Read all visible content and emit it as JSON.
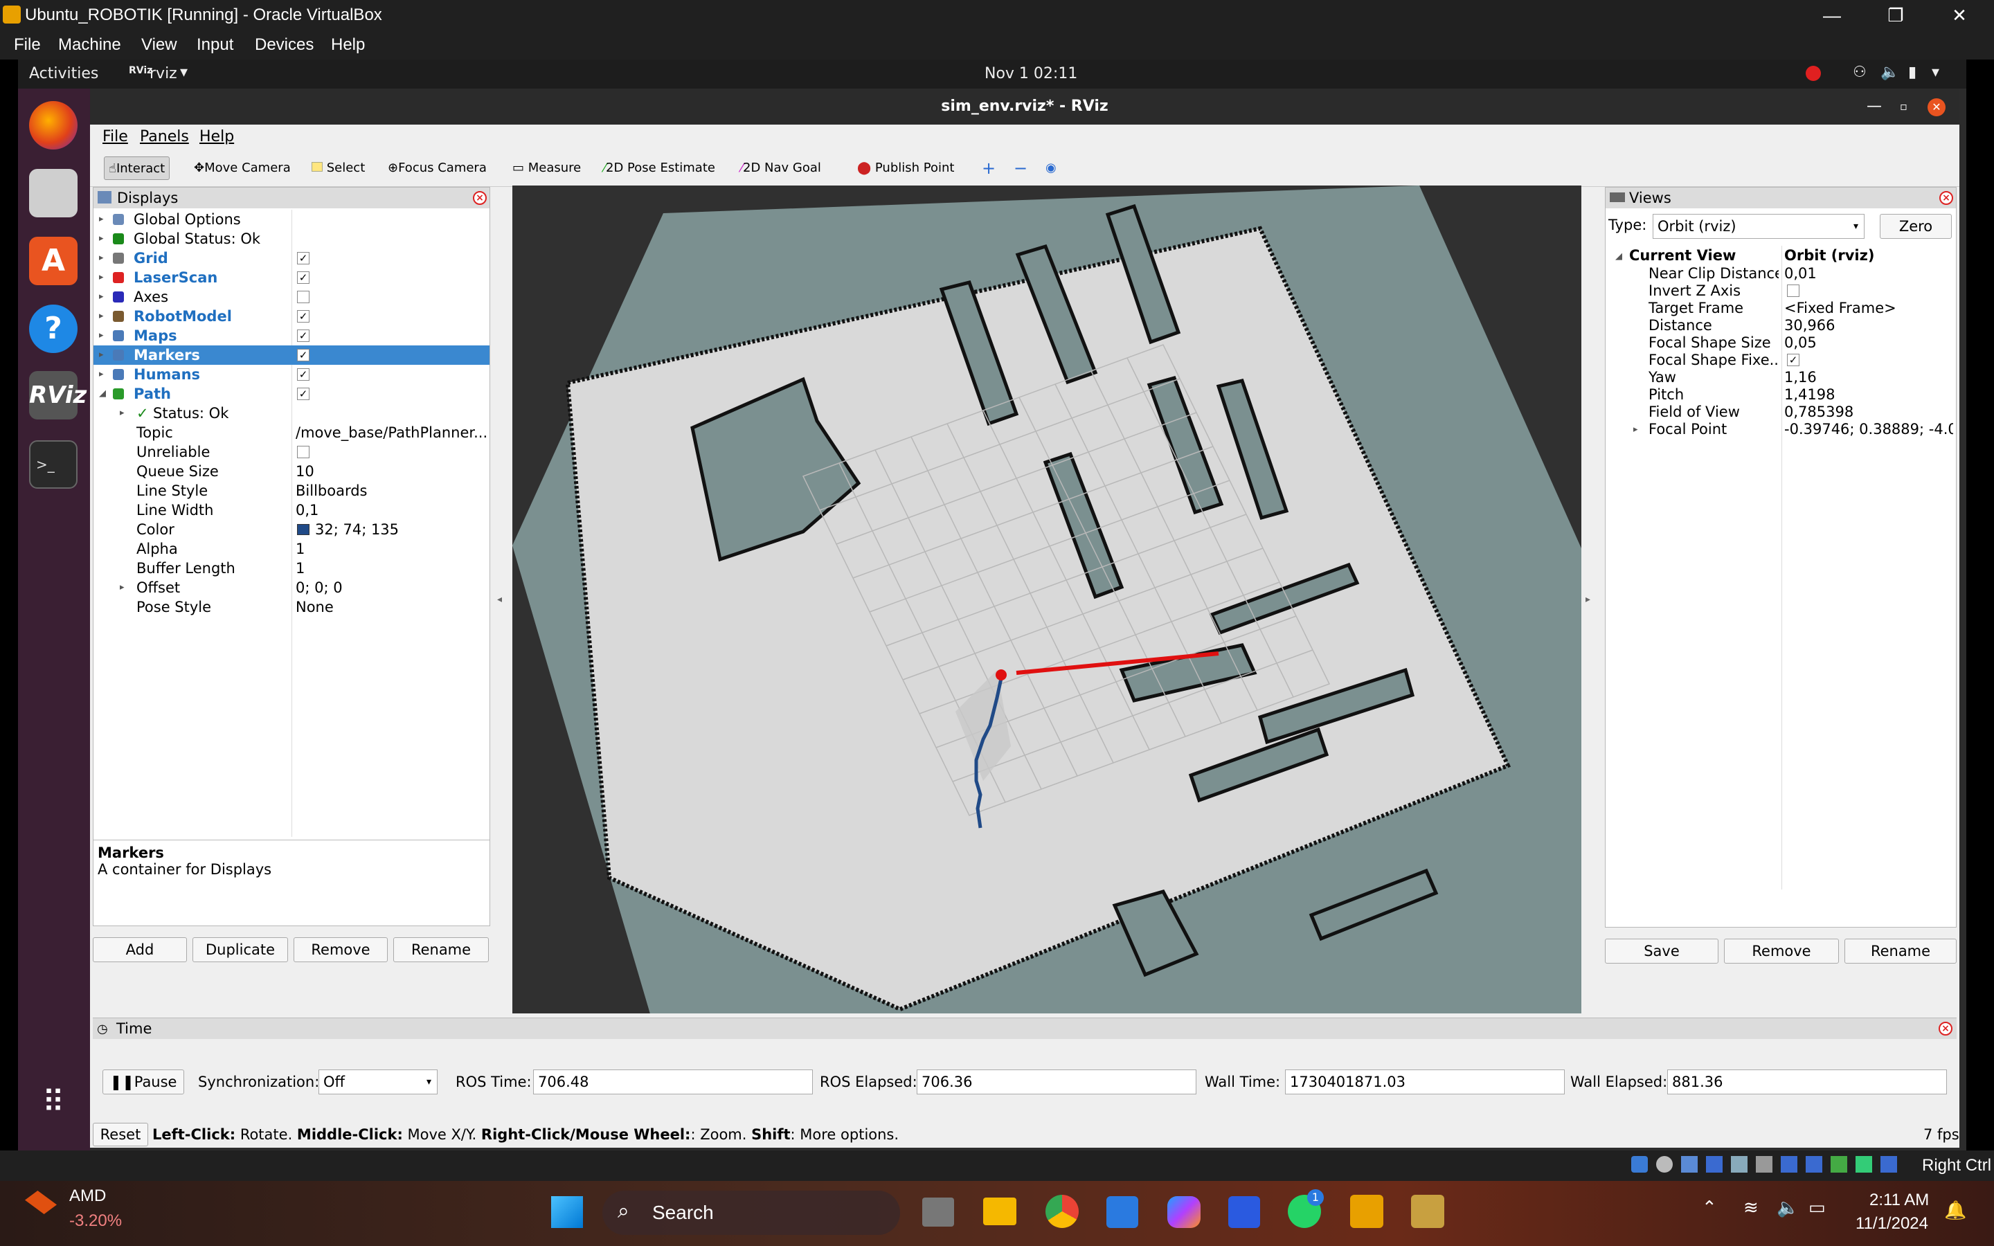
{
  "vbox": {
    "title": "Ubuntu_ROBOTIK [Running] - Oracle VirtualBox",
    "menu": [
      "File",
      "Machine",
      "View",
      "Input",
      "Devices",
      "Help"
    ],
    "status_right": "Right Ctrl"
  },
  "gnome": {
    "activities": "Activities",
    "app": "rviz",
    "clock": "Nov 1  02:11"
  },
  "rviz": {
    "title": "sim_env.rviz* - RViz",
    "menu": [
      "File",
      "Panels",
      "Help"
    ],
    "toolbar": [
      "Interact",
      "Move Camera",
      "Select",
      "Focus Camera",
      "Measure",
      "2D Pose Estimate",
      "2D Nav Goal",
      "Publish Point"
    ],
    "displays": {
      "title": "Displays",
      "items": [
        {
          "label": "Global Options",
          "value": ""
        },
        {
          "label": "Global Status: Ok",
          "value": ""
        },
        {
          "label": "Grid",
          "value": "checked"
        },
        {
          "label": "LaserScan",
          "value": "checked"
        },
        {
          "label": "Axes",
          "value": "unchecked"
        },
        {
          "label": "RobotModel",
          "value": "checked"
        },
        {
          "label": "Maps",
          "value": "checked"
        },
        {
          "label": "Markers",
          "value": "checked"
        },
        {
          "label": "Humans",
          "value": "checked"
        },
        {
          "label": "Path",
          "value": "checked"
        }
      ],
      "path_props": [
        {
          "label": "Status: Ok",
          "value": ""
        },
        {
          "label": "Topic",
          "value": "/move_base/PathPlanner..."
        },
        {
          "label": "Unreliable",
          "value": ""
        },
        {
          "label": "Queue Size",
          "value": "10"
        },
        {
          "label": "Line Style",
          "value": "Billboards"
        },
        {
          "label": "Line Width",
          "value": "0,1"
        },
        {
          "label": "Color",
          "value": "32; 74; 135"
        },
        {
          "label": "Alpha",
          "value": "1"
        },
        {
          "label": "Buffer Length",
          "value": "1"
        },
        {
          "label": "Offset",
          "value": "0; 0; 0"
        },
        {
          "label": "Pose Style",
          "value": "None"
        }
      ],
      "desc_title": "Markers",
      "desc_text": "A container for Displays",
      "buttons": [
        "Add",
        "Duplicate",
        "Remove",
        "Rename"
      ]
    },
    "views": {
      "title": "Views",
      "type_label": "Type:",
      "type_value": "Orbit (rviz)",
      "zero": "Zero",
      "current_view": "Current View",
      "current_view_value": "Orbit (rviz)",
      "props": [
        {
          "label": "Near Clip Distance",
          "value": "0,01"
        },
        {
          "label": "Invert Z Axis",
          "value": ""
        },
        {
          "label": "Target Frame",
          "value": "<Fixed Frame>"
        },
        {
          "label": "Distance",
          "value": "30,966"
        },
        {
          "label": "Focal Shape Size",
          "value": "0,05"
        },
        {
          "label": "Focal Shape Fixe...",
          "value": ""
        },
        {
          "label": "Yaw",
          "value": "1,16"
        },
        {
          "label": "Pitch",
          "value": "1,4198"
        },
        {
          "label": "Field of View",
          "value": "0,785398"
        },
        {
          "label": "Focal Point",
          "value": "-0.39746; 0.38889; -4.0..."
        }
      ],
      "buttons": [
        "Save",
        "Remove",
        "Rename"
      ]
    },
    "time": {
      "title": "Time",
      "pause": "Pause",
      "sync_label": "Synchronization:",
      "sync_value": "Off",
      "ros_time_label": "ROS Time:",
      "ros_time": "706.48",
      "ros_elapsed_label": "ROS Elapsed:",
      "ros_elapsed": "706.36",
      "wall_time_label": "Wall Time:",
      "wall_time": "1730401871.03",
      "wall_elapsed_label": "Wall Elapsed:",
      "wall_elapsed": "881.36"
    },
    "status": {
      "reset": "Reset",
      "lc": "Left-Click:",
      "lc_t": " Rotate. ",
      "mc": "Middle-Click:",
      "mc_t": " Move X/Y. ",
      "rc": "Right-Click/Mouse Wheel:",
      "rc_t": ": Zoom. ",
      "sh": "Shift",
      "sh_t": ": More options.",
      "fps": "7 fps"
    }
  },
  "windows": {
    "cpu_name": "AMD",
    "cpu_val": "-3.20%",
    "search": "Search",
    "whatsapp_badge": "1",
    "time": "2:11 AM",
    "date": "11/1/2024"
  },
  "colors": {
    "path": "#204a87",
    "laser": "#e01010",
    "map_free": "#d8d8d8",
    "map_unknown": "#7a8f8f",
    "bg": "#303030"
  }
}
